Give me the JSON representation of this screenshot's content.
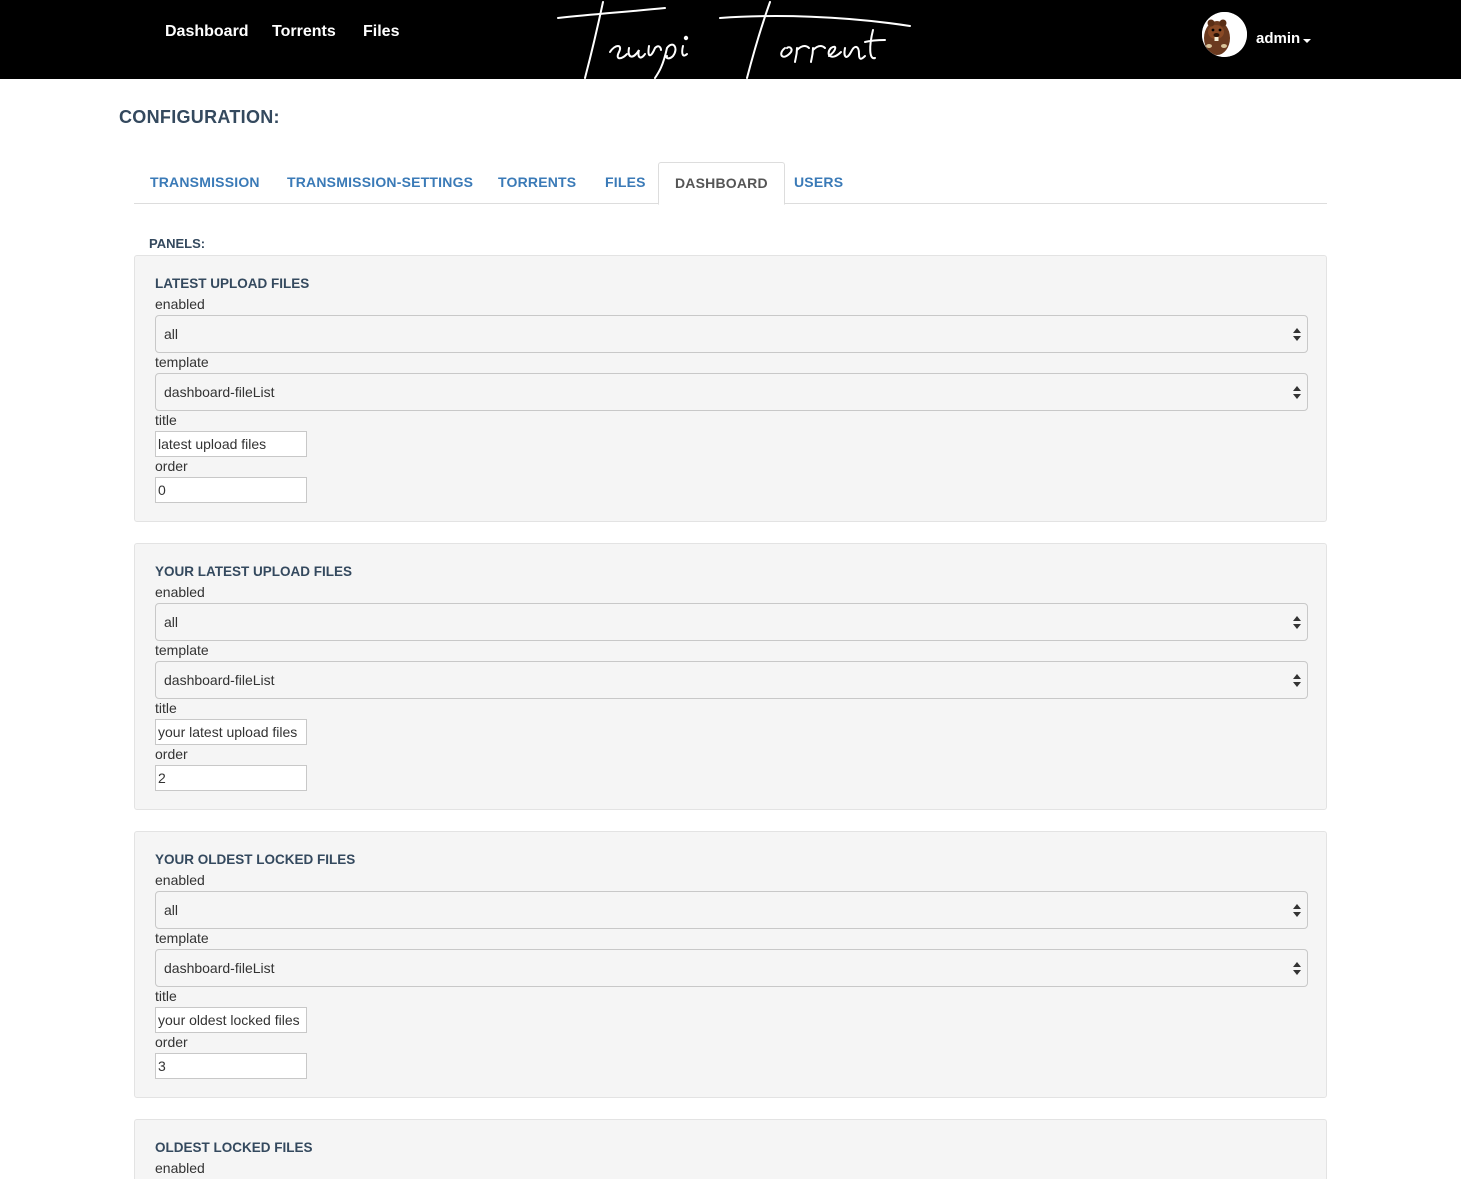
{
  "nav": {
    "links": [
      "Dashboard",
      "Torrents",
      "Files"
    ],
    "brand": "Teurpi Torrent",
    "user": "admin"
  },
  "page": {
    "title": "CONFIGURATION:",
    "tabs": [
      "TRANSMISSION",
      "TRANSMISSION-SETTINGS",
      "TORRENTS",
      "FILES",
      "DASHBOARD",
      "USERS"
    ],
    "active_tab": "DASHBOARD",
    "panels_label": "PANELS:"
  },
  "labels": {
    "enabled": "enabled",
    "template": "template",
    "title": "title",
    "order": "order"
  },
  "panels": [
    {
      "heading": "LATEST UPLOAD FILES",
      "enabled": "all",
      "template": "dashboard-fileList",
      "title": "latest upload files",
      "order": "0"
    },
    {
      "heading": "YOUR LATEST UPLOAD FILES",
      "enabled": "all",
      "template": "dashboard-fileList",
      "title": "your latest upload files",
      "order": "2"
    },
    {
      "heading": "YOUR OLDEST LOCKED FILES",
      "enabled": "all",
      "template": "dashboard-fileList",
      "title": "your oldest locked files",
      "order": "3"
    },
    {
      "heading": "OLDEST LOCKED FILES"
    }
  ]
}
